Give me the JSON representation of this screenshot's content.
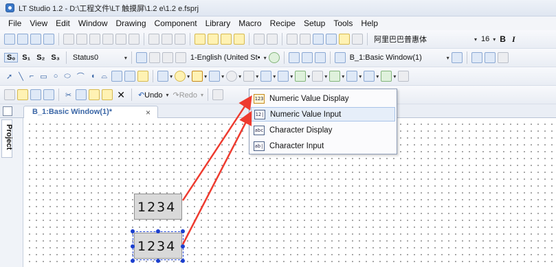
{
  "window": {
    "title": "LT Studio 1.2 - D:\\工程文件\\LT 触摸屏\\1.2 e\\1.2 e.fsprj"
  },
  "menu": [
    "File",
    "View",
    "Edit",
    "Window",
    "Drawing",
    "Component",
    "Library",
    "Macro",
    "Recipe",
    "Setup",
    "Tools",
    "Help"
  ],
  "toolbar1": {
    "font_name": "阿里巴巴普惠体",
    "font_size": "16",
    "bold_label": "B",
    "italic_label": "I"
  },
  "toolbar2": {
    "s0": "S₀",
    "s1": "S₁",
    "s2": "S₂",
    "s3": "S₃",
    "status": "Status0",
    "language": "1-English (United St▪",
    "window_select": "B_1:Basic Window(1)"
  },
  "toolbar4": {
    "undo": "Undo",
    "redo": "Redo"
  },
  "tab": {
    "label": "B_1:Basic Window(1)*",
    "close": "×"
  },
  "side_panel": {
    "label": "Project"
  },
  "dropdown": {
    "items": [
      {
        "icon": "123",
        "label": "Numeric Value Display"
      },
      {
        "icon": "12|",
        "label": "Numeric Value Input"
      },
      {
        "icon": "abc",
        "label": "Character Display"
      },
      {
        "icon": "ab|",
        "label": "Character Input"
      }
    ]
  },
  "canvas_objects": [
    {
      "kind": "numeric-value-display",
      "text": "1234"
    },
    {
      "kind": "numeric-value-input",
      "text": "1234"
    }
  ],
  "annotation_color": "#ee3b2f",
  "selection_color": "#1b3fcf"
}
